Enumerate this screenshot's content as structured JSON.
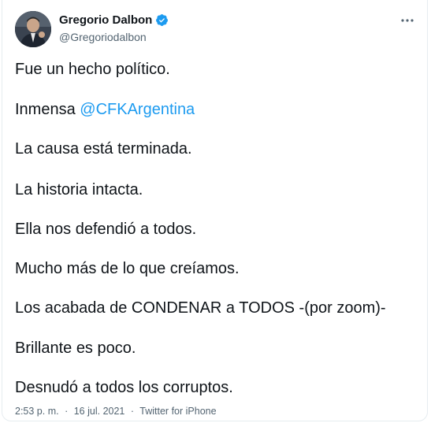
{
  "author": {
    "name": "Gregorio Dalbon",
    "handle": "@Gregoriodalbon",
    "verified": true
  },
  "icons": {
    "verified": "verified-badge-icon",
    "more": "more-options-icon"
  },
  "colors": {
    "text": "#0f1419",
    "secondary": "#536471",
    "accent": "#1d9bf0",
    "border": "#e6ecf0"
  },
  "tweet": {
    "line1": "Fue un hecho político.",
    "line2_prefix": "Inmensa ",
    "line2_mention": "@CFKArgentina",
    "line3": "La causa está terminada.",
    "line4": "La historia intacta.",
    "line5": "Ella nos defendió a todos.",
    "line6": "Mucho más de lo que creíamos.",
    "line7": "Los acabada de CONDENAR a TODOS -(por zoom)-",
    "line8": "Brillante es poco.",
    "line9": "Desnudó a todos los corruptos."
  },
  "meta": {
    "time": "2:53 p. m.",
    "separator": "·",
    "date": "16 jul. 2021",
    "source": "Twitter for iPhone"
  }
}
